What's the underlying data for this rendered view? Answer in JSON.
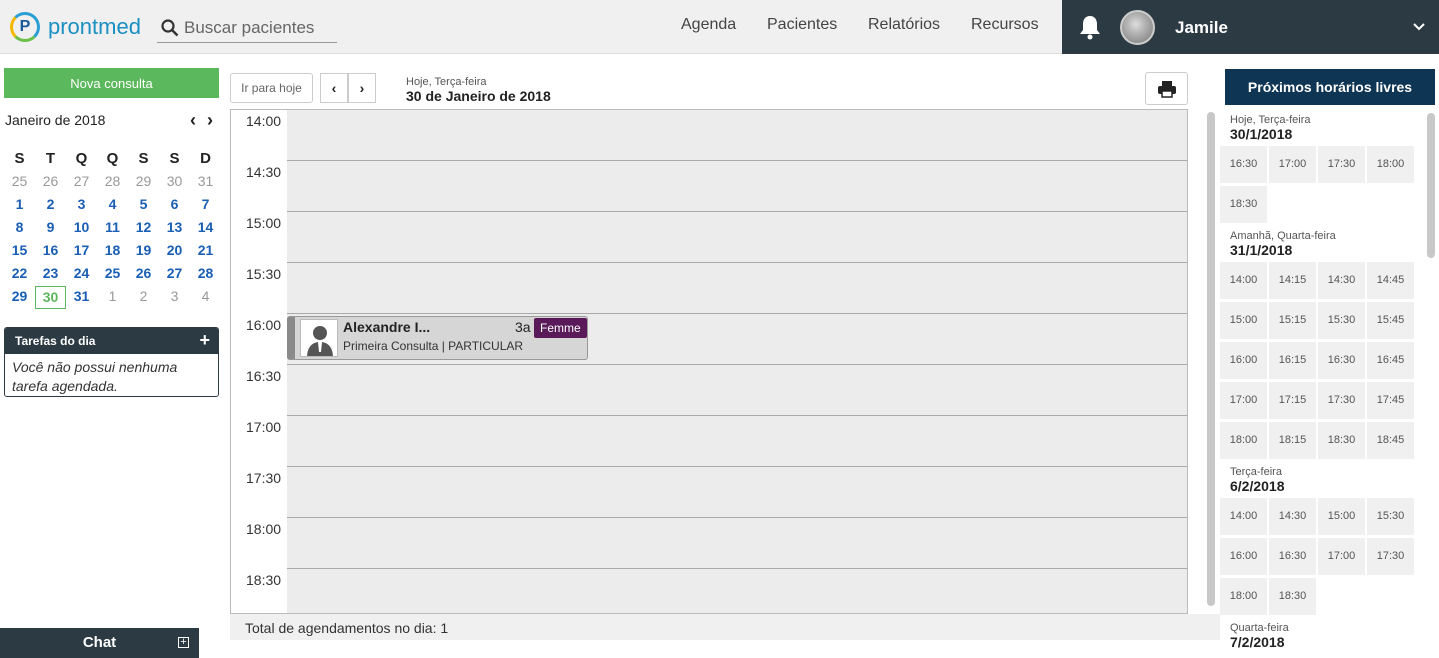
{
  "header": {
    "logo_text": "prontmed",
    "logo_letter": "P",
    "search_placeholder": "Buscar pacientes",
    "nav": [
      "Agenda",
      "Pacientes",
      "Relatórios",
      "Recursos"
    ],
    "username": "Jamile"
  },
  "sidebar": {
    "new_button": "Nova consulta",
    "month_label": "Janeiro de 2018",
    "prev_arrow": "‹",
    "next_arrow": "›",
    "weekdays": [
      "S",
      "T",
      "Q",
      "Q",
      "S",
      "S",
      "D"
    ],
    "weeks": [
      [
        "25",
        "26",
        "27",
        "28",
        "29",
        "30",
        "31"
      ],
      [
        "1",
        "2",
        "3",
        "4",
        "5",
        "6",
        "7"
      ],
      [
        "8",
        "9",
        "10",
        "11",
        "12",
        "13",
        "14"
      ],
      [
        "15",
        "16",
        "17",
        "18",
        "19",
        "20",
        "21"
      ],
      [
        "22",
        "23",
        "24",
        "25",
        "26",
        "27",
        "28"
      ],
      [
        "29",
        "30",
        "31",
        "1",
        "2",
        "3",
        "4"
      ]
    ],
    "today_value": "30",
    "tasks_title": "Tarefas do dia",
    "tasks_plus": "+",
    "tasks_empty": "Você não possui nenhuma tarefa agendada.",
    "chat_label": "Chat",
    "chat_plus": "+"
  },
  "toolbar": {
    "today_button": "Ir para hoje",
    "prev": "‹",
    "next": "›",
    "date_sub": "Hoje, Terça-feira",
    "date_main": "30 de Janeiro de 2018"
  },
  "agenda": {
    "times": [
      "14:00",
      "14:30",
      "15:00",
      "15:30",
      "16:00",
      "16:30",
      "17:00",
      "17:30",
      "18:00",
      "18:30"
    ],
    "appointment": {
      "name": "Alexandre I...",
      "age": "3a",
      "description": "Primeira Consulta | PARTICULAR",
      "tag": "Femme"
    },
    "total_label": "Total de agendamentos no dia: 1"
  },
  "free_slots": {
    "title": "Próximos horários livres",
    "days": [
      {
        "sub": "Hoje, Terça-feira",
        "date": "30/1/2018",
        "times": [
          "16:30",
          "17:00",
          "17:30",
          "18:00",
          "18:30"
        ]
      },
      {
        "sub": "Amanhã, Quarta-feira",
        "date": "31/1/2018",
        "times": [
          "14:00",
          "14:15",
          "14:30",
          "14:45",
          "15:00",
          "15:15",
          "15:30",
          "15:45",
          "16:00",
          "16:15",
          "16:30",
          "16:45",
          "17:00",
          "17:15",
          "17:30",
          "17:45",
          "18:00",
          "18:15",
          "18:30",
          "18:45"
        ]
      },
      {
        "sub": "Terça-feira",
        "date": "6/2/2018",
        "times": [
          "14:00",
          "14:30",
          "15:00",
          "15:30",
          "16:00",
          "16:30",
          "17:00",
          "17:30",
          "18:00",
          "18:30"
        ]
      },
      {
        "sub": "Quarta-feira",
        "date": "7/2/2018",
        "times": []
      }
    ]
  }
}
